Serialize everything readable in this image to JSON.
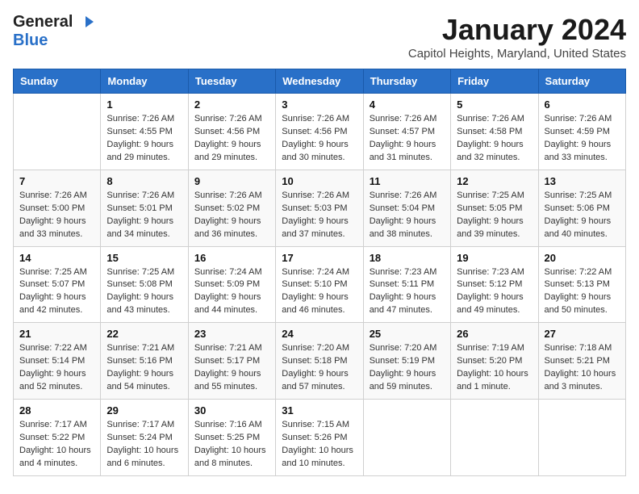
{
  "header": {
    "logo_general": "General",
    "logo_blue": "Blue",
    "title": "January 2024",
    "subtitle": "Capitol Heights, Maryland, United States"
  },
  "weekdays": [
    "Sunday",
    "Monday",
    "Tuesday",
    "Wednesday",
    "Thursday",
    "Friday",
    "Saturday"
  ],
  "weeks": [
    [
      {
        "day": "",
        "info": ""
      },
      {
        "day": "1",
        "info": "Sunrise: 7:26 AM\nSunset: 4:55 PM\nDaylight: 9 hours\nand 29 minutes."
      },
      {
        "day": "2",
        "info": "Sunrise: 7:26 AM\nSunset: 4:56 PM\nDaylight: 9 hours\nand 29 minutes."
      },
      {
        "day": "3",
        "info": "Sunrise: 7:26 AM\nSunset: 4:56 PM\nDaylight: 9 hours\nand 30 minutes."
      },
      {
        "day": "4",
        "info": "Sunrise: 7:26 AM\nSunset: 4:57 PM\nDaylight: 9 hours\nand 31 minutes."
      },
      {
        "day": "5",
        "info": "Sunrise: 7:26 AM\nSunset: 4:58 PM\nDaylight: 9 hours\nand 32 minutes."
      },
      {
        "day": "6",
        "info": "Sunrise: 7:26 AM\nSunset: 4:59 PM\nDaylight: 9 hours\nand 33 minutes."
      }
    ],
    [
      {
        "day": "7",
        "info": "Sunrise: 7:26 AM\nSunset: 5:00 PM\nDaylight: 9 hours\nand 33 minutes."
      },
      {
        "day": "8",
        "info": "Sunrise: 7:26 AM\nSunset: 5:01 PM\nDaylight: 9 hours\nand 34 minutes."
      },
      {
        "day": "9",
        "info": "Sunrise: 7:26 AM\nSunset: 5:02 PM\nDaylight: 9 hours\nand 36 minutes."
      },
      {
        "day": "10",
        "info": "Sunrise: 7:26 AM\nSunset: 5:03 PM\nDaylight: 9 hours\nand 37 minutes."
      },
      {
        "day": "11",
        "info": "Sunrise: 7:26 AM\nSunset: 5:04 PM\nDaylight: 9 hours\nand 38 minutes."
      },
      {
        "day": "12",
        "info": "Sunrise: 7:25 AM\nSunset: 5:05 PM\nDaylight: 9 hours\nand 39 minutes."
      },
      {
        "day": "13",
        "info": "Sunrise: 7:25 AM\nSunset: 5:06 PM\nDaylight: 9 hours\nand 40 minutes."
      }
    ],
    [
      {
        "day": "14",
        "info": "Sunrise: 7:25 AM\nSunset: 5:07 PM\nDaylight: 9 hours\nand 42 minutes."
      },
      {
        "day": "15",
        "info": "Sunrise: 7:25 AM\nSunset: 5:08 PM\nDaylight: 9 hours\nand 43 minutes."
      },
      {
        "day": "16",
        "info": "Sunrise: 7:24 AM\nSunset: 5:09 PM\nDaylight: 9 hours\nand 44 minutes."
      },
      {
        "day": "17",
        "info": "Sunrise: 7:24 AM\nSunset: 5:10 PM\nDaylight: 9 hours\nand 46 minutes."
      },
      {
        "day": "18",
        "info": "Sunrise: 7:23 AM\nSunset: 5:11 PM\nDaylight: 9 hours\nand 47 minutes."
      },
      {
        "day": "19",
        "info": "Sunrise: 7:23 AM\nSunset: 5:12 PM\nDaylight: 9 hours\nand 49 minutes."
      },
      {
        "day": "20",
        "info": "Sunrise: 7:22 AM\nSunset: 5:13 PM\nDaylight: 9 hours\nand 50 minutes."
      }
    ],
    [
      {
        "day": "21",
        "info": "Sunrise: 7:22 AM\nSunset: 5:14 PM\nDaylight: 9 hours\nand 52 minutes."
      },
      {
        "day": "22",
        "info": "Sunrise: 7:21 AM\nSunset: 5:16 PM\nDaylight: 9 hours\nand 54 minutes."
      },
      {
        "day": "23",
        "info": "Sunrise: 7:21 AM\nSunset: 5:17 PM\nDaylight: 9 hours\nand 55 minutes."
      },
      {
        "day": "24",
        "info": "Sunrise: 7:20 AM\nSunset: 5:18 PM\nDaylight: 9 hours\nand 57 minutes."
      },
      {
        "day": "25",
        "info": "Sunrise: 7:20 AM\nSunset: 5:19 PM\nDaylight: 9 hours\nand 59 minutes."
      },
      {
        "day": "26",
        "info": "Sunrise: 7:19 AM\nSunset: 5:20 PM\nDaylight: 10 hours\nand 1 minute."
      },
      {
        "day": "27",
        "info": "Sunrise: 7:18 AM\nSunset: 5:21 PM\nDaylight: 10 hours\nand 3 minutes."
      }
    ],
    [
      {
        "day": "28",
        "info": "Sunrise: 7:17 AM\nSunset: 5:22 PM\nDaylight: 10 hours\nand 4 minutes."
      },
      {
        "day": "29",
        "info": "Sunrise: 7:17 AM\nSunset: 5:24 PM\nDaylight: 10 hours\nand 6 minutes."
      },
      {
        "day": "30",
        "info": "Sunrise: 7:16 AM\nSunset: 5:25 PM\nDaylight: 10 hours\nand 8 minutes."
      },
      {
        "day": "31",
        "info": "Sunrise: 7:15 AM\nSunset: 5:26 PM\nDaylight: 10 hours\nand 10 minutes."
      },
      {
        "day": "",
        "info": ""
      },
      {
        "day": "",
        "info": ""
      },
      {
        "day": "",
        "info": ""
      }
    ]
  ]
}
